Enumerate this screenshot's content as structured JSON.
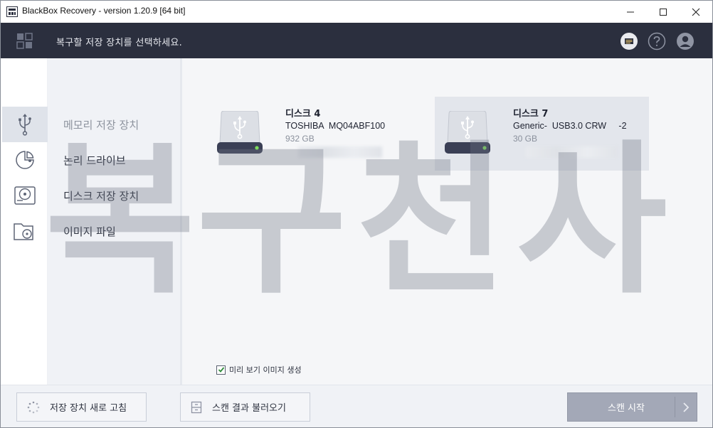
{
  "window": {
    "title": "BlackBox Recovery - version 1.20.9 [64 bit]"
  },
  "header": {
    "prompt": "복구할 저장 장치를 선택하세요.",
    "icons": [
      "grid-menu-icon",
      "license-key-icon",
      "help-icon",
      "account-icon"
    ]
  },
  "sidebar": {
    "items": [
      {
        "label": "메모리 저장 장치",
        "icon": "usb-icon",
        "active": true
      },
      {
        "label": "논리 드라이브",
        "icon": "pie-partition-icon",
        "active": false
      },
      {
        "label": "디스크 저장 장치",
        "icon": "hard-disk-icon",
        "active": false
      },
      {
        "label": "이미지 파일",
        "icon": "image-file-icon",
        "active": false
      }
    ]
  },
  "disks": [
    {
      "name": "디스크 4",
      "model": "TOSHIBA  MQ04ABF100",
      "size": "932 GB",
      "selected": false
    },
    {
      "name": "디스크 7",
      "model": "Generic-  USB3.0 CRW     -2",
      "size": "30 GB",
      "selected": true
    }
  ],
  "preview_option": {
    "label": "미리 보기 이미지 생성",
    "checked": true
  },
  "footer": {
    "refresh_label": "저장 장치 새로 고침",
    "load_label": "스캔 결과 불러오기",
    "start_label": "스캔 시작"
  },
  "watermark": {
    "text": [
      "복",
      "구",
      "천",
      "사"
    ]
  },
  "colors": {
    "header_bg": "#2b2f3e",
    "start_button": "#a3a8b7",
    "sidebar_bg": "#f0f2f6",
    "checkbox_accent": "#2e8b3a"
  }
}
